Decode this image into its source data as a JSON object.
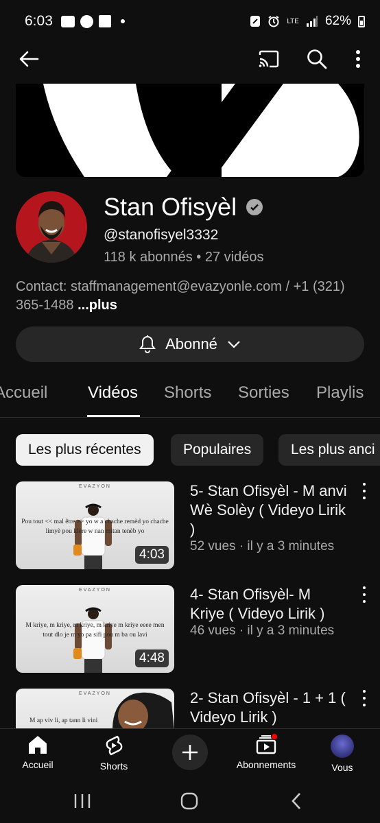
{
  "status_bar": {
    "time": "6:03",
    "network": "LTE",
    "battery": "62%"
  },
  "channel": {
    "name": "Stan Ofisyèl",
    "handle": "@stanofisyel3332",
    "stats": "118 k abonnés • 27 vidéos",
    "contact": "Contact: staffmanagement@evazyonle.com / +1 (321) 365-1488",
    "more_label": "...plus",
    "subscribe_label": "Abonné"
  },
  "tabs": [
    "Accueil",
    "Vidéos",
    "Shorts",
    "Sorties",
    "Playlis"
  ],
  "active_tab": "Vidéos",
  "chips": [
    "Les plus récentes",
    "Populaires",
    "Les plus anci"
  ],
  "videos": [
    {
      "title": "5- Stan Ofisyèl - M anvi Wè Solèy ( Videyo Lirik )",
      "meta": "52 vues · il y a 3 minutes",
      "duration": "4:03",
      "thumb_brand": "EVAZYON",
      "thumb_text": "Pou tout << mal être >> yo w a chache remèd yo chache limyè pou klere w nan mitan tenèb yo"
    },
    {
      "title": "4- Stan Ofisyèl- M Kriye ( Videyo Lirik )",
      "meta": "46 vues · il y a 3 minutes",
      "duration": "4:48",
      "thumb_brand": "EVAZYON",
      "thumb_text": "M kriye, m kriye, m kriye, m kriye m kriye eeee men tout dlo je m yo pa sifi pou m ba ou lavi"
    },
    {
      "title": "2- Stan Ofisyèl - 1 + 1 ( Videyo Lirik )",
      "meta": "",
      "duration": "",
      "thumb_brand": "EVAZYON",
      "thumb_text": "M ap viv li, ap tann li vini"
    }
  ],
  "bottom_nav": {
    "home": "Accueil",
    "shorts": "Shorts",
    "subscriptions": "Abonnements",
    "you": "Vous"
  },
  "colors": {
    "background": "#0f0f0f",
    "surface": "#272727",
    "text_secondary": "#aaaaaa",
    "notification": "#ff0000"
  }
}
